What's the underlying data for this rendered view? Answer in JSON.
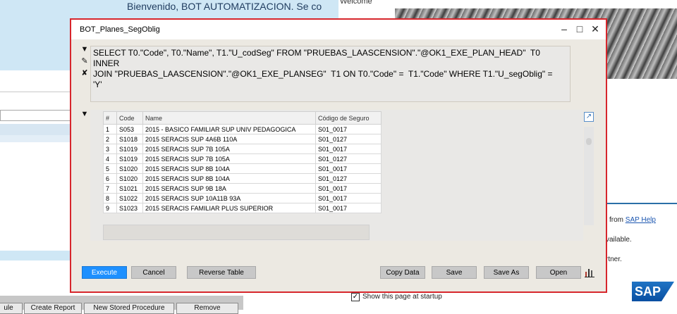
{
  "background": {
    "welcome_text": "Bienvenido, BOT AUTOMATIZACION. Se co",
    "welcome_title": "Welcome",
    "from_prefix": "from ",
    "help_link": "SAP Help",
    "available": "vailable.",
    "partner": "rtner.",
    "show_startup": "Show this page at startup",
    "sap_logo": "SAP",
    "bottom_buttons": [
      "ule",
      "Create Report",
      "New Stored Procedure",
      "Remove"
    ]
  },
  "window": {
    "title": "BOT_Planes_SegOblig",
    "minimize_icon": "minimize-icon",
    "maximize_icon": "maximize-icon",
    "close_icon": "close-icon"
  },
  "query": {
    "text": "SELECT T0.\"Code\", T0.\"Name\", T1.\"U_codSeg\" FROM \"PRUEBAS_LAASCENSION\".\"@OK1_EXE_PLAN_HEAD\"  T0 INNER\nJOIN \"PRUEBAS_LAASCENSION\".\"@OK1_EXE_PLANSEG\"  T1 ON T0.\"Code\" =  T1.\"Code\" WHERE T1.\"U_segOblig\" =\n'Y'"
  },
  "grid": {
    "columns": [
      "#",
      "Code",
      "Name",
      "Código de Seguro"
    ],
    "rows": [
      [
        "1",
        "S053",
        "2015 - BASICO FAMILIAR SUP UNIV PEDAGOGICA",
        "S01_0017"
      ],
      [
        "2",
        "S1018",
        "2015 SERACIS SUP  4A6B 110A",
        "S01_0127"
      ],
      [
        "3",
        "S1019",
        "2015 SERACIS SUP 7B 105A",
        "S01_0017"
      ],
      [
        "4",
        "S1019",
        "2015 SERACIS SUP 7B 105A",
        "S01_0127"
      ],
      [
        "5",
        "S1020",
        "2015 SERACIS SUP 8B 104A",
        "S01_0017"
      ],
      [
        "6",
        "S1020",
        "2015 SERACIS SUP 8B 104A",
        "S01_0127"
      ],
      [
        "7",
        "S1021",
        "2015 SERACIS SUP 9B 18A",
        "S01_0017"
      ],
      [
        "8",
        "S1022",
        "2015 SERACIS SUP 10A11B 93A",
        "S01_0017"
      ],
      [
        "9",
        "S1023",
        "2015 SERACIS FAMILIAR PLUS SUPERIOR",
        "S01_0017"
      ]
    ]
  },
  "buttons": {
    "execute": "Execute",
    "cancel": "Cancel",
    "reverse_table": "Reverse Table",
    "copy_data": "Copy Data",
    "save": "Save",
    "save_as": "Save As",
    "open": "Open"
  },
  "colors": {
    "window_border": "#d7262c",
    "execute_bg": "#1e90ff",
    "window_bg": "#ece9e2"
  }
}
